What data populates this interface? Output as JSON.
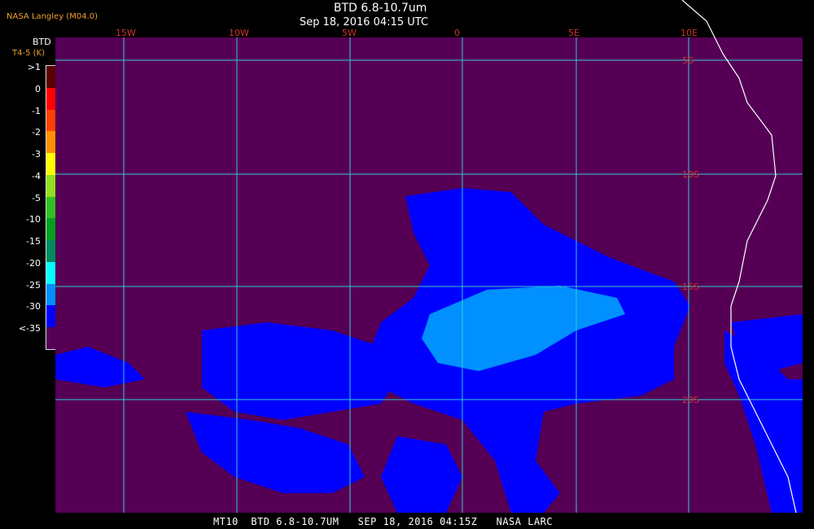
{
  "header": {
    "source": "NASA Langley (M04.0)",
    "title": "BTD 6.8-10.7um",
    "date": "Sep 18, 2016 04:15 UTC"
  },
  "legend": {
    "title": "BTD",
    "subtitle": "T4-5 (K)",
    "items": [
      {
        "label": ">1",
        "color": "#5a0000"
      },
      {
        "label": "0",
        "color": "#ff0000"
      },
      {
        "label": "-1",
        "color": "#ff4000"
      },
      {
        "label": "-2",
        "color": "#ff9000"
      },
      {
        "label": "-3",
        "color": "#ffff00"
      },
      {
        "label": "-4",
        "color": "#90e020"
      },
      {
        "label": "-5",
        "color": "#30c020"
      },
      {
        "label": "-10",
        "color": "#00a020"
      },
      {
        "label": "-15",
        "color": "#008c60"
      },
      {
        "label": "-20",
        "color": "#00ffff"
      },
      {
        "label": "-25",
        "color": "#0090ff"
      },
      {
        "label": "-30",
        "color": "#0000ff"
      },
      {
        "label": "<-35",
        "color": "#550055"
      }
    ]
  },
  "map": {
    "background_color": "#550055",
    "grid_color": "#33cccc",
    "label_color": "#cc3333",
    "coast_color": "#ffffff",
    "lon_labels": [
      "15W",
      "10W",
      "5W",
      "0",
      "5E",
      "10E"
    ],
    "lat_labels": [
      "5S",
      "10S",
      "15S",
      "20S"
    ]
  },
  "footer": {
    "text": "MT10  BTD 6.8-10.7UM   SEP 18, 2016 04:15Z   NASA LARC"
  }
}
